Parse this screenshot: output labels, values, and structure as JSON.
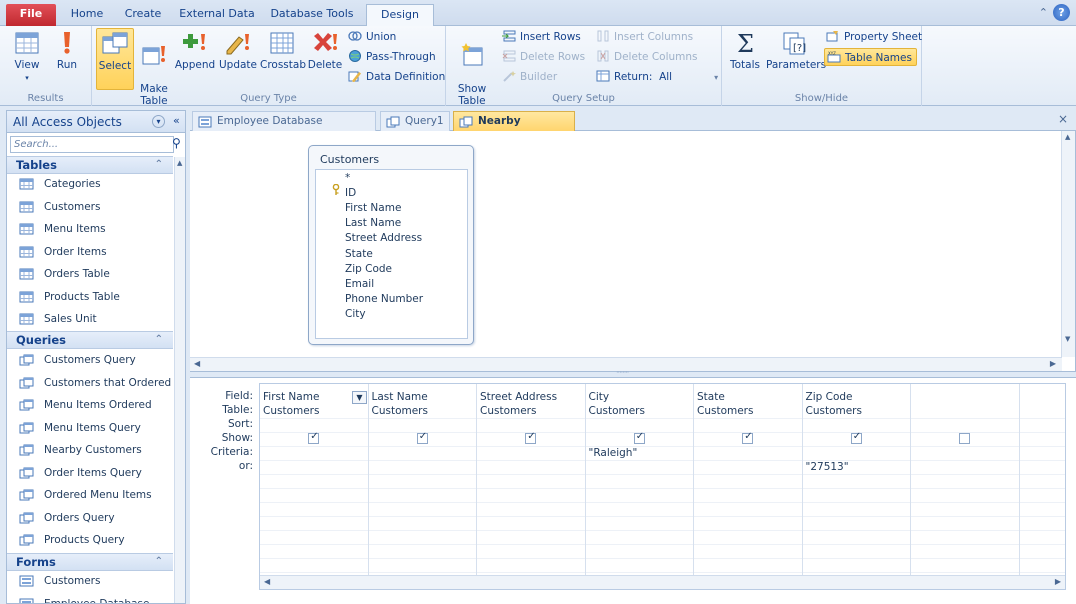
{
  "ribbon_tabs": [
    "File",
    "Home",
    "Create",
    "External Data",
    "Database Tools",
    "Design"
  ],
  "active_tab": "Design",
  "ribbon": {
    "results": {
      "label": "Results",
      "view": "View",
      "run": "Run"
    },
    "query_type": {
      "label": "Query Type",
      "select": "Select",
      "make_table": "Make\nTable",
      "append": "Append",
      "update": "Update",
      "crosstab": "Crosstab",
      "delete": "Delete",
      "union": "Union",
      "pass_through": "Pass-Through",
      "data_definition": "Data Definition"
    },
    "query_setup": {
      "label": "Query Setup",
      "show_table": "Show\nTable",
      "insert_rows": "Insert Rows",
      "delete_rows": "Delete Rows",
      "builder": "Builder",
      "insert_columns": "Insert Columns",
      "delete_columns": "Delete Columns",
      "return_label": "Return:",
      "return_value": "All"
    },
    "show_hide": {
      "label": "Show/Hide",
      "totals": "Totals",
      "parameters": "Parameters",
      "property_sheet": "Property Sheet",
      "table_names": "Table Names"
    }
  },
  "nav": {
    "header": "All Access Objects",
    "search_placeholder": "Search...",
    "tables_header": "Tables",
    "tables": [
      "Categories",
      "Customers",
      "Menu Items",
      "Order Items",
      "Orders Table",
      "Products Table",
      "Sales Unit"
    ],
    "queries_header": "Queries",
    "queries": [
      "Customers Query",
      "Customers that Ordered",
      "Menu Items Ordered",
      "Menu Items Query",
      "Nearby Customers",
      "Order Items Query",
      "Ordered Menu Items",
      "Orders Query",
      "Products Query"
    ],
    "forms_header": "Forms",
    "forms": [
      "Customers",
      "Employee Database Na..."
    ]
  },
  "doc_tabs": [
    "Employee Database Navigation",
    "Query1",
    "Nearby Customers"
  ],
  "table_box": {
    "title": "Customers",
    "fields": [
      "*",
      "ID",
      "First Name",
      "Last Name",
      "Street Address",
      "State",
      "Zip Code",
      "Email",
      "Phone Number",
      "City"
    ]
  },
  "grid": {
    "row_labels": [
      "Field:",
      "Table:",
      "Sort:",
      "Show:",
      "Criteria:",
      "or:"
    ],
    "columns": [
      {
        "field": "First Name",
        "table": "Customers",
        "show": true,
        "criteria": "",
        "or": ""
      },
      {
        "field": "Last Name",
        "table": "Customers",
        "show": true,
        "criteria": "",
        "or": ""
      },
      {
        "field": "Street Address",
        "table": "Customers",
        "show": true,
        "criteria": "",
        "or": ""
      },
      {
        "field": "City",
        "table": "Customers",
        "show": true,
        "criteria": "\"Raleigh\"",
        "or": ""
      },
      {
        "field": "State",
        "table": "Customers",
        "show": true,
        "criteria": "",
        "or": ""
      },
      {
        "field": "Zip Code",
        "table": "Customers",
        "show": true,
        "criteria": "",
        "or": "\"27513\""
      },
      {
        "field": "",
        "table": "",
        "show": false,
        "criteria": "",
        "or": ""
      }
    ]
  },
  "colors": {
    "accent": "#15428b",
    "file_tab": "#c0282f",
    "highlight": "#ffd25a",
    "chrome": "#dfe9f5"
  }
}
